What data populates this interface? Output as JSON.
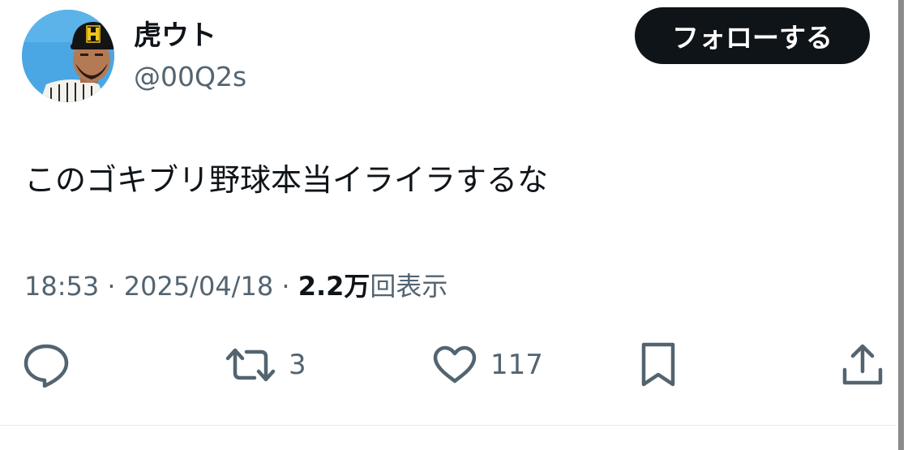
{
  "author": {
    "display_name": "虎ウト",
    "handle": "@00Q2s",
    "avatar_icon": "avatar-baseball-player"
  },
  "follow_button": {
    "label": "フォローする"
  },
  "tweet": {
    "text": "このゴキブリ野球本当イライラするな",
    "time": "18:53",
    "separator": " · ",
    "date": "2025/04/18",
    "views_count": "2.2万",
    "views_label": "回表示"
  },
  "actions": {
    "reply_icon": "reply-icon",
    "retweet_icon": "retweet-icon",
    "retweet_count": "3",
    "like_icon": "heart-icon",
    "like_count": "117",
    "bookmark_icon": "bookmark-icon",
    "share_icon": "share-icon"
  },
  "colors": {
    "text_primary": "#0f1419",
    "text_secondary": "#536471",
    "button_bg": "#0f1419",
    "button_text": "#ffffff",
    "avatar_bg": "#4aa7e3",
    "divider": "#e7eaeb"
  }
}
